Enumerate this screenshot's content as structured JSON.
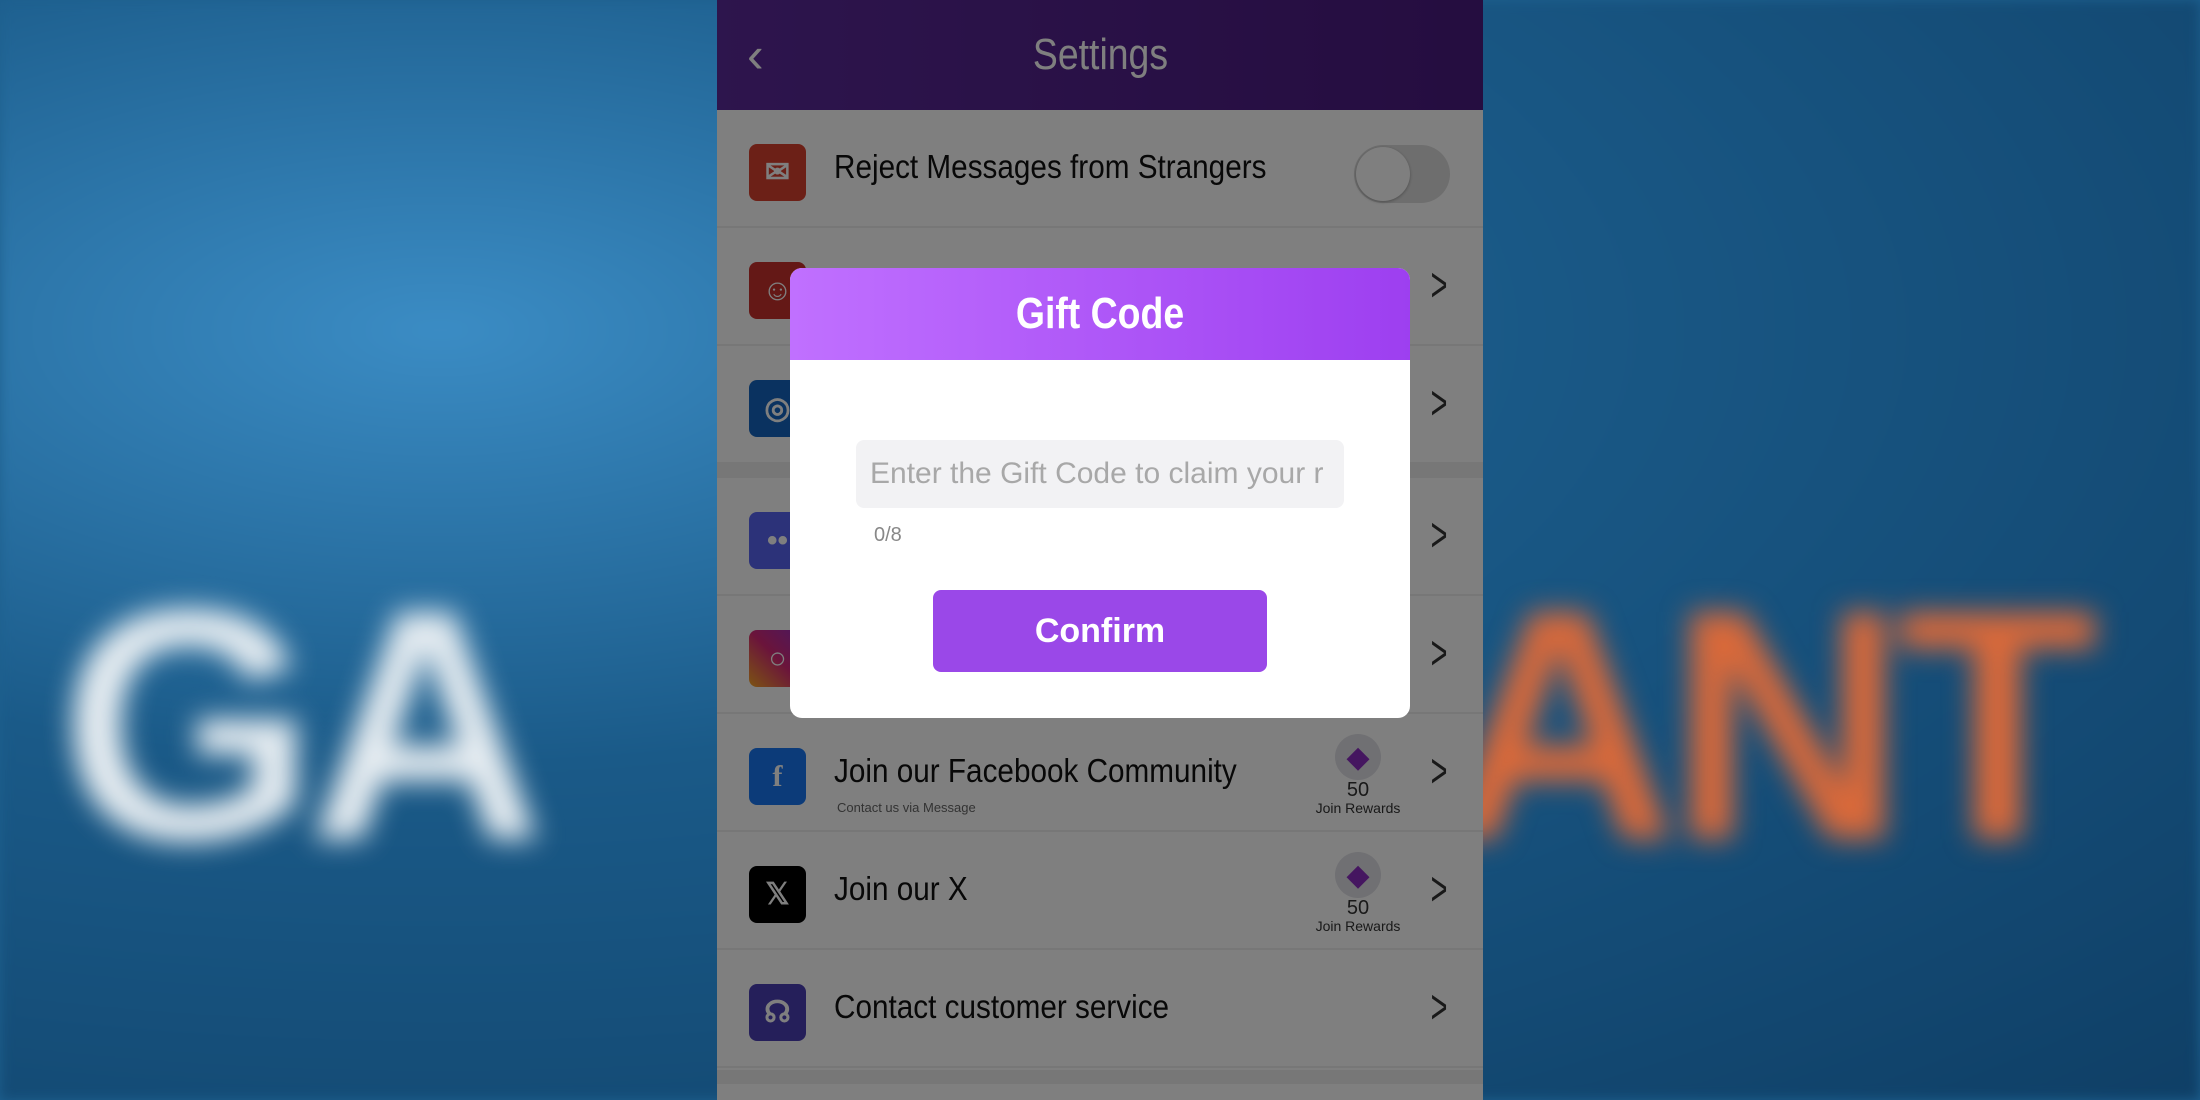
{
  "background_text": {
    "left": "GA",
    "right": "ANT"
  },
  "header": {
    "title": "Settings",
    "back_icon": "chevron-left-icon"
  },
  "rows": [
    {
      "label": "Reject Messages from Strangers",
      "icon": "message-block-icon",
      "color": "#d9412e",
      "toggle": false
    },
    {
      "label": "",
      "icon": "user-icon",
      "color": "#c9302c"
    },
    {
      "label": "",
      "icon": "globe-icon",
      "color": "#1565c0"
    },
    {
      "label": "",
      "icon": "discord-icon",
      "color": "#5865f2"
    },
    {
      "label": "",
      "icon": "instagram-icon",
      "color": "#d62976"
    },
    {
      "label": "Join our Facebook Community",
      "sub": "Contact us via Message",
      "icon": "facebook-icon",
      "color": "#1877f2",
      "reward": {
        "amount": "50",
        "label": "Join Rewards"
      }
    },
    {
      "label": "Join our X",
      "icon": "x-icon",
      "color": "#000000",
      "reward": {
        "amount": "50",
        "label": "Join Rewards"
      }
    },
    {
      "label": "Contact customer service",
      "icon": "headset-icon",
      "color": "#4b3fb5"
    }
  ],
  "modal": {
    "title": "Gift Code",
    "placeholder": "Enter the Gift Code to claim your r",
    "value": "",
    "counter": "0/8",
    "confirm": "Confirm"
  },
  "colors": {
    "accent": "#9a48e8",
    "header": "#4a1a80"
  }
}
